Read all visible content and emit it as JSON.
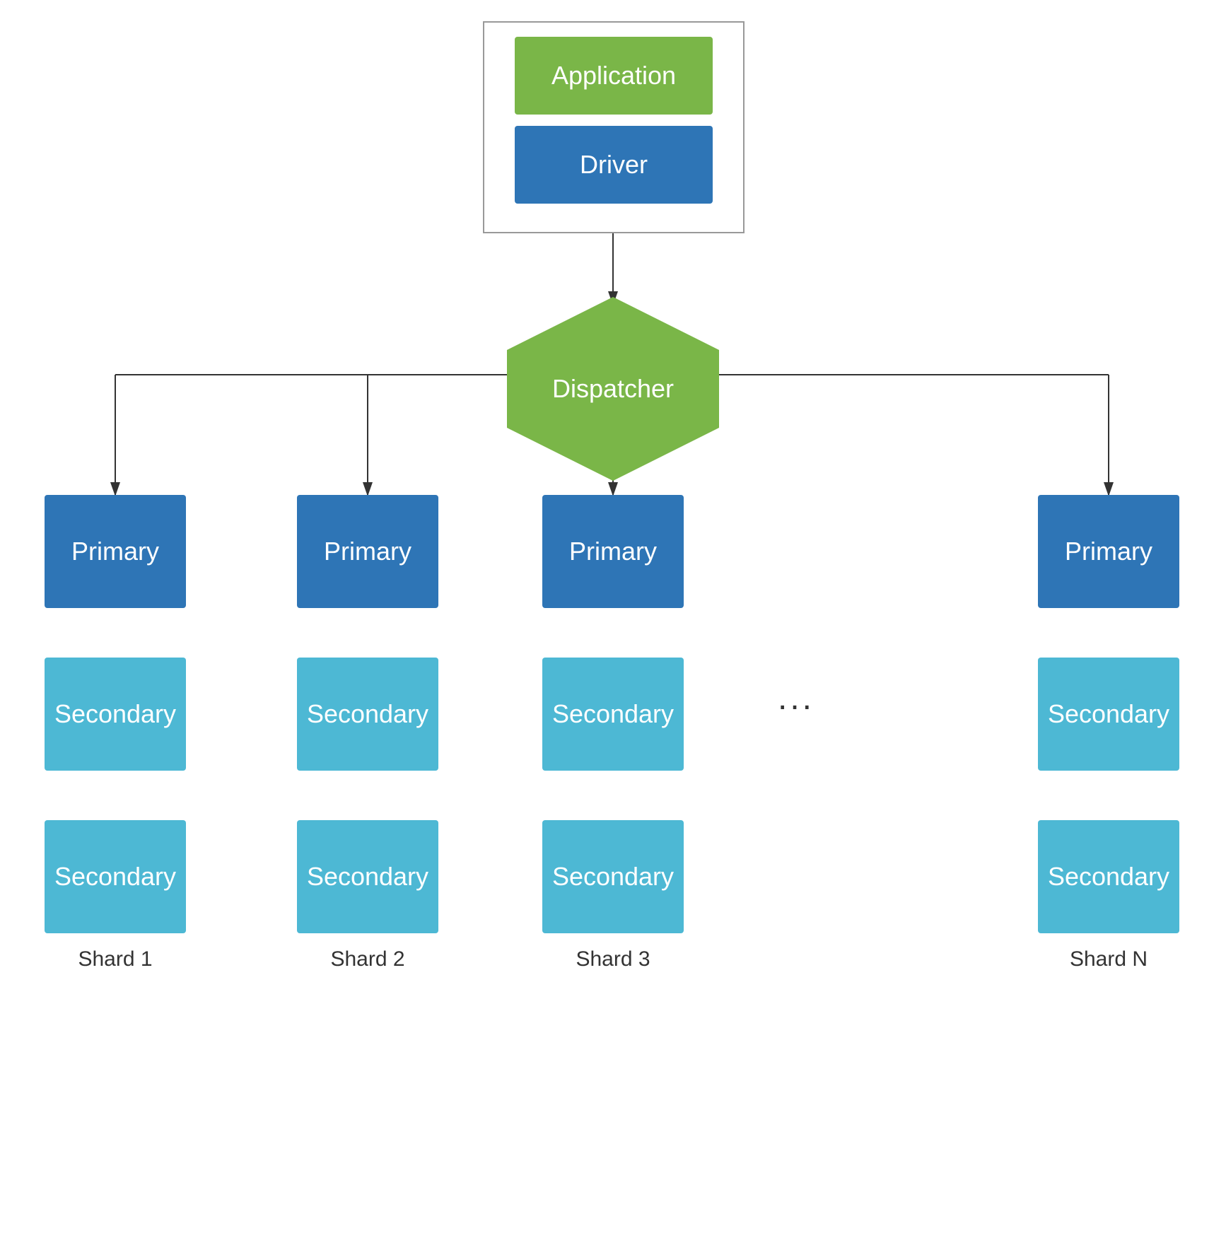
{
  "nodes": {
    "application": {
      "label": "Application"
    },
    "driver": {
      "label": "Driver"
    },
    "dispatcher": {
      "label": "Dispatcher"
    },
    "primary": {
      "label": "Primary"
    },
    "secondary": {
      "label": "Secondary"
    },
    "shards": [
      "Shard 1",
      "Shard 2",
      "Shard 3",
      "Shard N"
    ],
    "dots": "..."
  },
  "colors": {
    "green": "#7ab648",
    "blue_dark": "#2e75b6",
    "blue_light": "#4db8d4",
    "border": "#999"
  }
}
